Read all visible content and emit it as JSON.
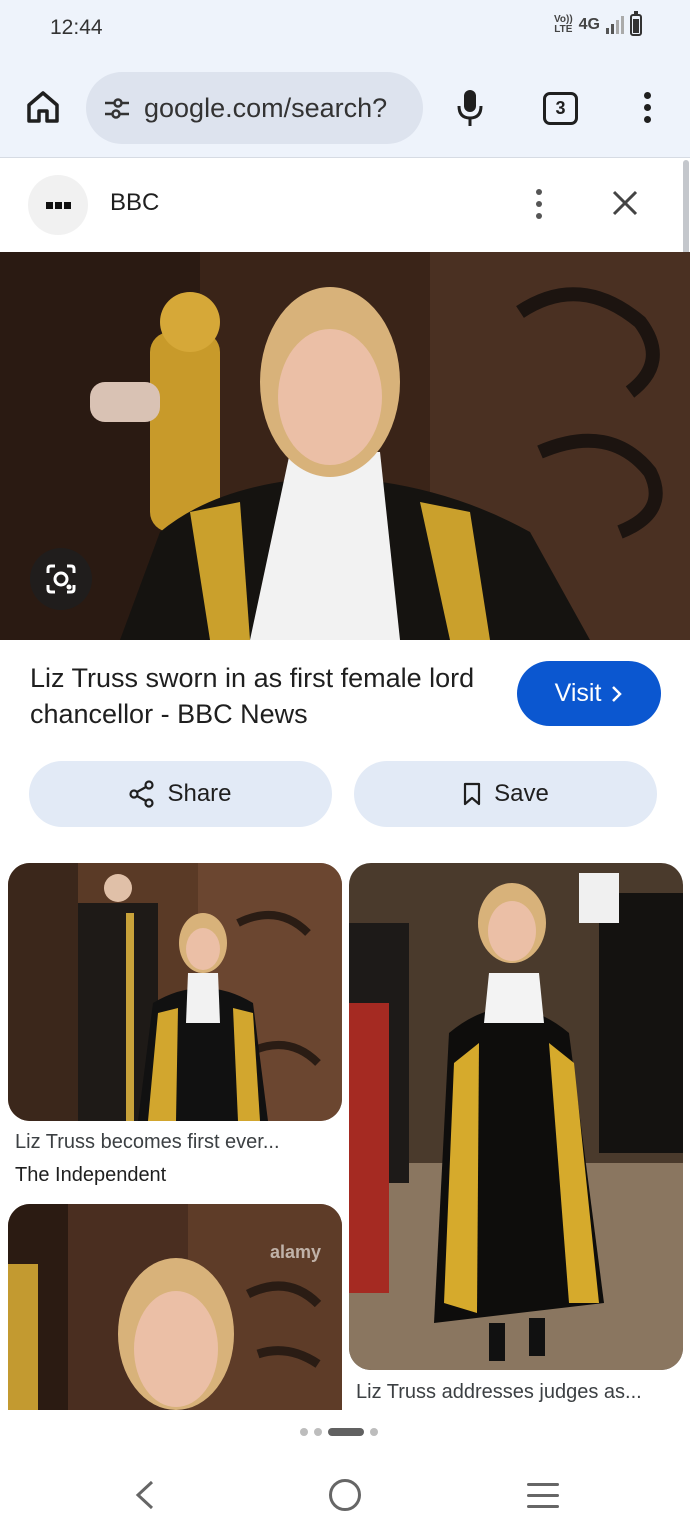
{
  "status_bar": {
    "time": "12:44",
    "volte": "Vo)) LTE",
    "network": "4G"
  },
  "browser": {
    "url": "google.com/search?",
    "tab_count": "3"
  },
  "source": {
    "name": "BBC"
  },
  "result": {
    "title": "Liz Truss sworn in as first female lord chancellor - BBC News",
    "visit_label": "Visit",
    "share_label": "Share",
    "save_label": "Save"
  },
  "related": [
    {
      "caption": "Liz Truss becomes first ever...",
      "source": "The Independent"
    },
    {
      "caption": "Liz Truss addresses judges as..."
    },
    {
      "watermark": "alamy"
    }
  ],
  "colors": {
    "visit_button": "#0b57d0",
    "toolbar_bg": "#eef3fb",
    "pill_bg": "#e2eaf6"
  }
}
